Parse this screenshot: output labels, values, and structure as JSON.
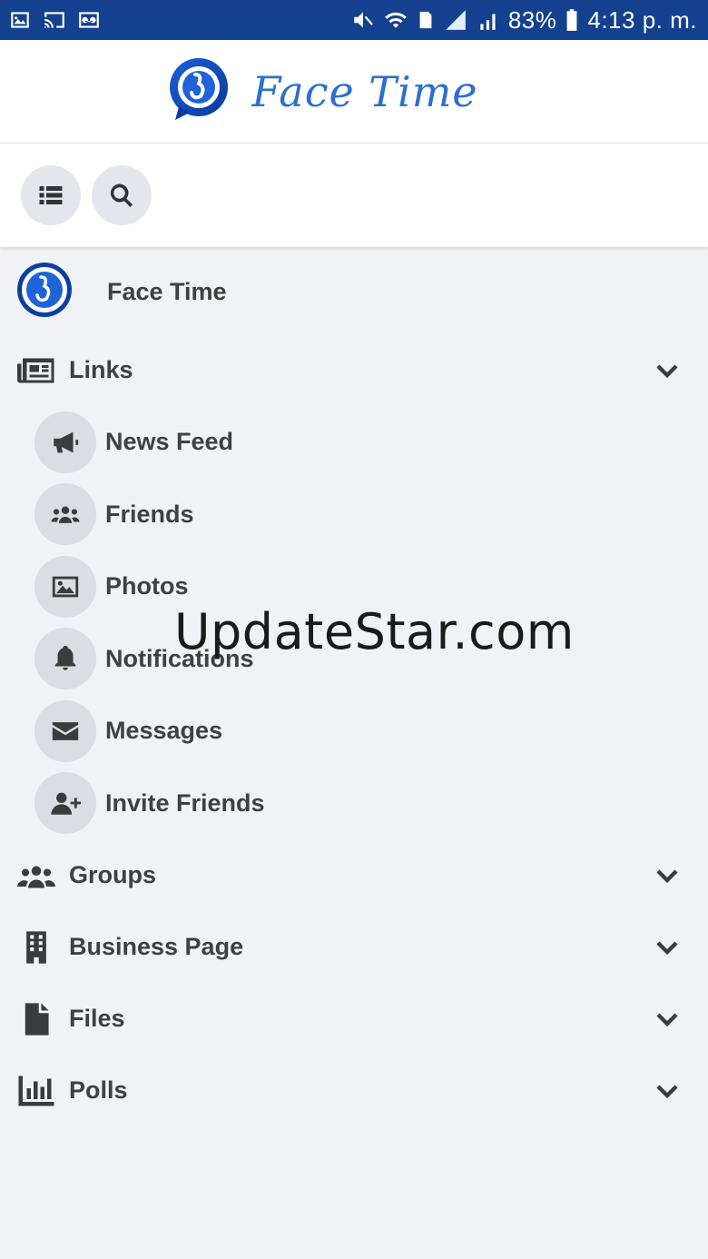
{
  "status_bar": {
    "battery": "83%",
    "time": "4:13 p. m.",
    "sim_slot": "1",
    "left_icons": [
      "gallery-icon",
      "cast-icon",
      "voicemail-icon"
    ],
    "right_icons": [
      "mute-icon",
      "wifi-icon",
      "sim-icon",
      "signal-icon",
      "battery-icon"
    ],
    "bg_color": "#13418f"
  },
  "header": {
    "app_name": "Face Time",
    "brand_color": "#2d6fcc"
  },
  "toolbar": {
    "buttons": [
      "menu-list-icon",
      "search-icon"
    ]
  },
  "menu": {
    "profile_name": "Face Time",
    "links": {
      "label": "Links",
      "expanded": true,
      "items": [
        {
          "label": "News Feed",
          "icon": "megaphone-icon"
        },
        {
          "label": "Friends",
          "icon": "users-icon"
        },
        {
          "label": "Photos",
          "icon": "image-icon"
        },
        {
          "label": "Notifications",
          "icon": "bell-icon"
        },
        {
          "label": "Messages",
          "icon": "envelope-icon"
        },
        {
          "label": "Invite Friends",
          "icon": "user-plus-icon"
        }
      ]
    },
    "sections": [
      {
        "label": "Groups",
        "icon": "group-icon"
      },
      {
        "label": "Business Page",
        "icon": "building-icon"
      },
      {
        "label": "Files",
        "icon": "file-icon"
      },
      {
        "label": "Polls",
        "icon": "poll-chart-icon"
      }
    ]
  },
  "watermark": "UpdateStar.com"
}
